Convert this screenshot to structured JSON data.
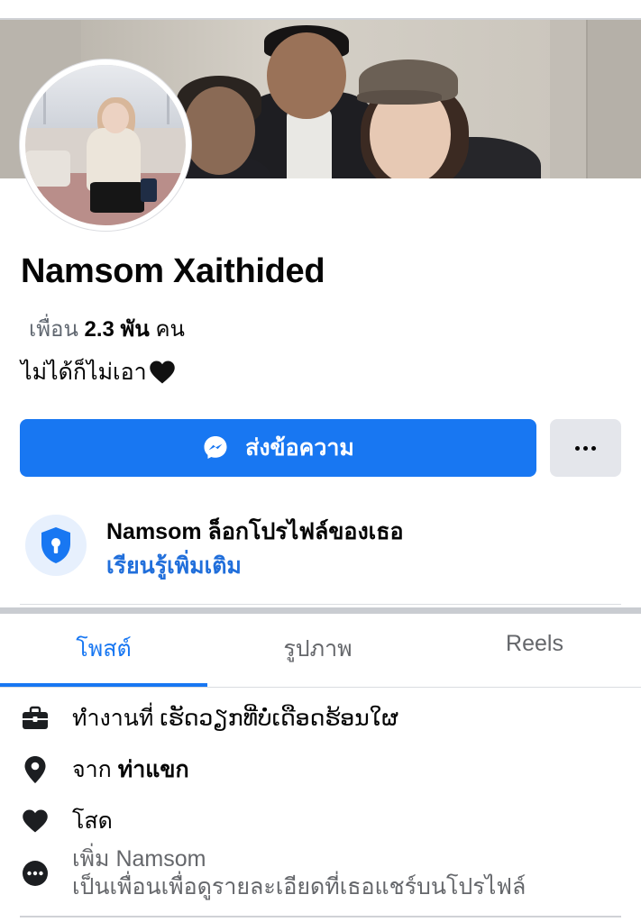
{
  "profile": {
    "name": "Namsom Xaithided",
    "friends_prefix": "เพื่อน",
    "friends_count": "2.3 พัน",
    "friends_suffix": "คน",
    "bio": "ไม่ได้ก็ไม่เอา"
  },
  "actions": {
    "message_label": "ส่งข้อความ",
    "more_label": "more-options"
  },
  "lock_notice": {
    "name": "Namsom",
    "text": "ล็อกโปรไฟล์ของเธอ",
    "link": "เรียนรู้เพิ่มเติม"
  },
  "tabs": [
    {
      "label": "โพสต์",
      "active": true
    },
    {
      "label": "รูปภาพ",
      "active": false
    },
    {
      "label": "Reels",
      "active": false
    }
  ],
  "details": {
    "work_prefix": "ทำงานที่",
    "work_value": "ເຮັດວຽກທີ່ບໍ່ເດືອດຮ້ອນໃຜ",
    "from_prefix": "จาก",
    "from_value": "ท่าแขก",
    "relationship": "โสด",
    "add_friend_line1": "เพิ่ม Namsom",
    "add_friend_line2": "เป็นเพื่อนเพื่อดูรายละเอียดที่เธอแชร์บนโปรไฟล์"
  },
  "colors": {
    "accent": "#1877f2",
    "link": "#216fdb",
    "secondary_text": "#65676b",
    "button_grey": "#e4e6eb"
  },
  "icons": [
    "messenger-icon",
    "more-dots-icon",
    "shield-lock-icon",
    "briefcase-icon",
    "location-pin-icon",
    "heart-icon",
    "more-circle-icon",
    "black-heart-emoji"
  ]
}
